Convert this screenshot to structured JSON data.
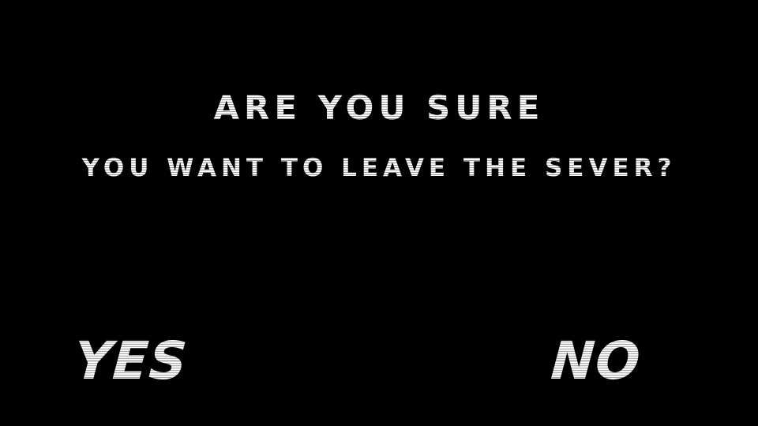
{
  "dialog": {
    "title_line1": "ARE YOU SURE",
    "title_line2": "YOU WANT TO LEAVE THE SEVER?",
    "yes_label": "YES",
    "no_label": "NO"
  },
  "colors": {
    "background": "#000000",
    "text_primary": "#ffffff",
    "text_stripe": "#9a9a9a"
  }
}
